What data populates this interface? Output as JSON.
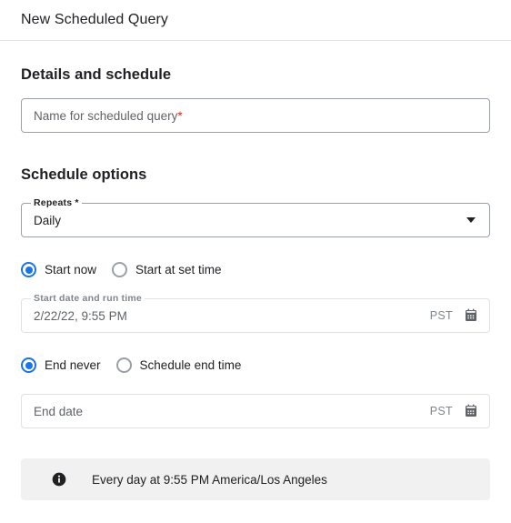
{
  "header": {
    "title": "New Scheduled Query"
  },
  "sections": {
    "details": {
      "heading": "Details and schedule",
      "name_field": {
        "placeholder": "Name for scheduled query",
        "required_marker": "*",
        "value": ""
      }
    },
    "schedule": {
      "heading": "Schedule options",
      "repeats_field": {
        "label": "Repeats *",
        "value": "Daily",
        "dropdown_icon": "chevron-down-icon"
      },
      "start_radios": {
        "options": [
          {
            "label": "Start now",
            "selected": true
          },
          {
            "label": "Start at set time",
            "selected": false
          }
        ]
      },
      "start_date_field": {
        "label": "Start date and run time",
        "value": "2/22/22, 9:55 PM",
        "timezone": "PST",
        "calendar_icon": "calendar-icon",
        "disabled": true
      },
      "end_radios": {
        "options": [
          {
            "label": "End never",
            "selected": true
          },
          {
            "label": "Schedule end time",
            "selected": false
          }
        ]
      },
      "end_date_field": {
        "placeholder": "End date",
        "value": "",
        "timezone": "PST",
        "calendar_icon": "calendar-icon",
        "disabled": true
      }
    }
  },
  "info_banner": {
    "icon": "info-icon",
    "message": "Every day at 9:55 PM America/Los Angeles"
  },
  "colors": {
    "accent": "#1a73e8",
    "required": "#d93025",
    "text": "#202124",
    "muted": "#5f6368",
    "border": "#9aa0a6",
    "border_disabled": "#dfe1e3",
    "banner_bg": "#f1f1f1"
  }
}
